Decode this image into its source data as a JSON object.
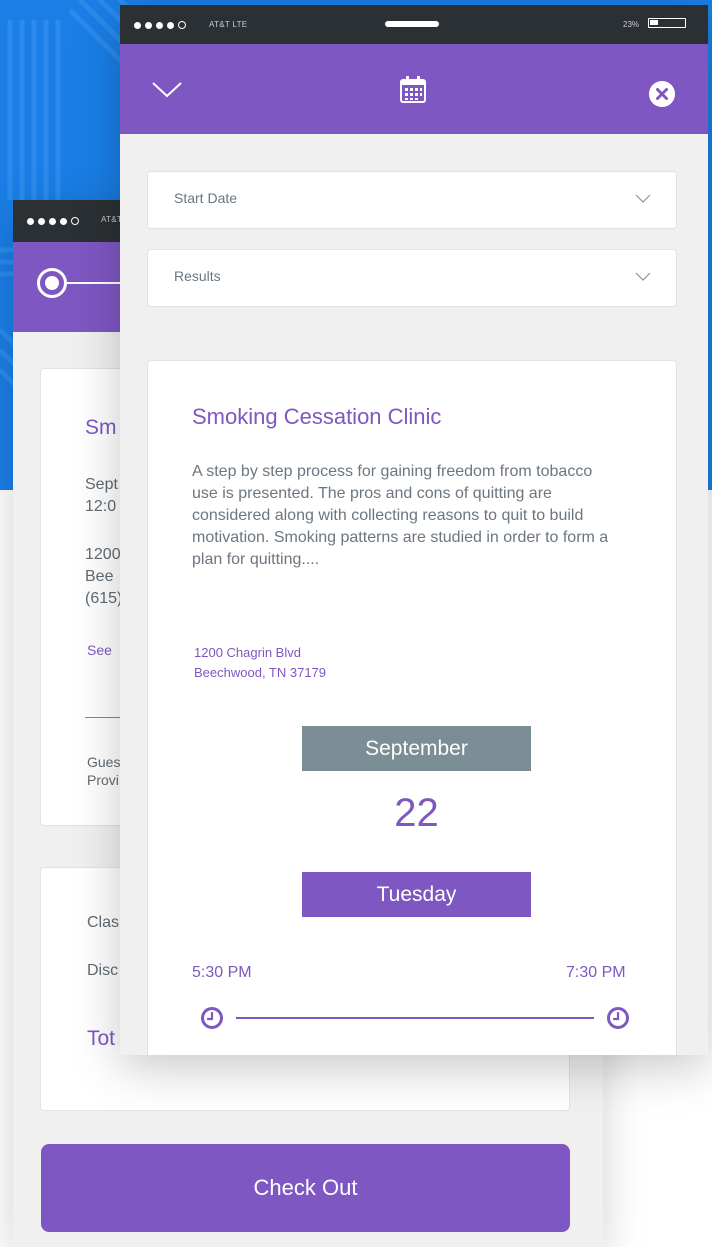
{
  "theme": {
    "accent": "#7e57c2",
    "backdrop": "#1a7ee6",
    "status_bar": "#2b3034",
    "month_bar": "#7b8d95"
  },
  "back_screen": {
    "status": {
      "carrier": "AT&T"
    },
    "summary_card": {
      "title_fragment": "Sm",
      "date_line1": "Sept",
      "date_line2": "12:0",
      "addr_line1": "1200",
      "addr_line2": "Bee",
      "phone_line": "(615)",
      "link_fragment": "See",
      "guest_line1": "Gues",
      "guest_line2": "Provi"
    },
    "totals_card": {
      "class_fragment": "Clas",
      "discount_fragment": "Disc",
      "total_fragment": "Tot"
    },
    "checkout_label": "Check Out"
  },
  "front_screen": {
    "status": {
      "carrier": "AT&T LTE",
      "battery_percent": "23%",
      "battery_level": 0.23
    },
    "header": {
      "collapse_icon": "chevron-down-icon",
      "center_icon": "calendar-icon",
      "close_icon": "close-icon"
    },
    "filters": [
      {
        "label": "Start Date",
        "icon": "chevron-down-icon"
      },
      {
        "label": "Results",
        "icon": "chevron-down-icon"
      }
    ],
    "event": {
      "title": "Smoking Cessation Clinic",
      "description": "A step by step process for gaining freedom from tobacco use is presented. The pros and cons of quitting are considered along with collecting reasons to quit to build motivation. Smoking patterns are studied in order to form a plan for quitting....",
      "address_line1": "1200 Chagrin Blvd",
      "address_line2": "Beechwood, TN 37179",
      "month": "September",
      "day": "22",
      "weekday": "Tuesday",
      "start_time": "5:30 PM",
      "end_time": "7:30 PM"
    }
  }
}
